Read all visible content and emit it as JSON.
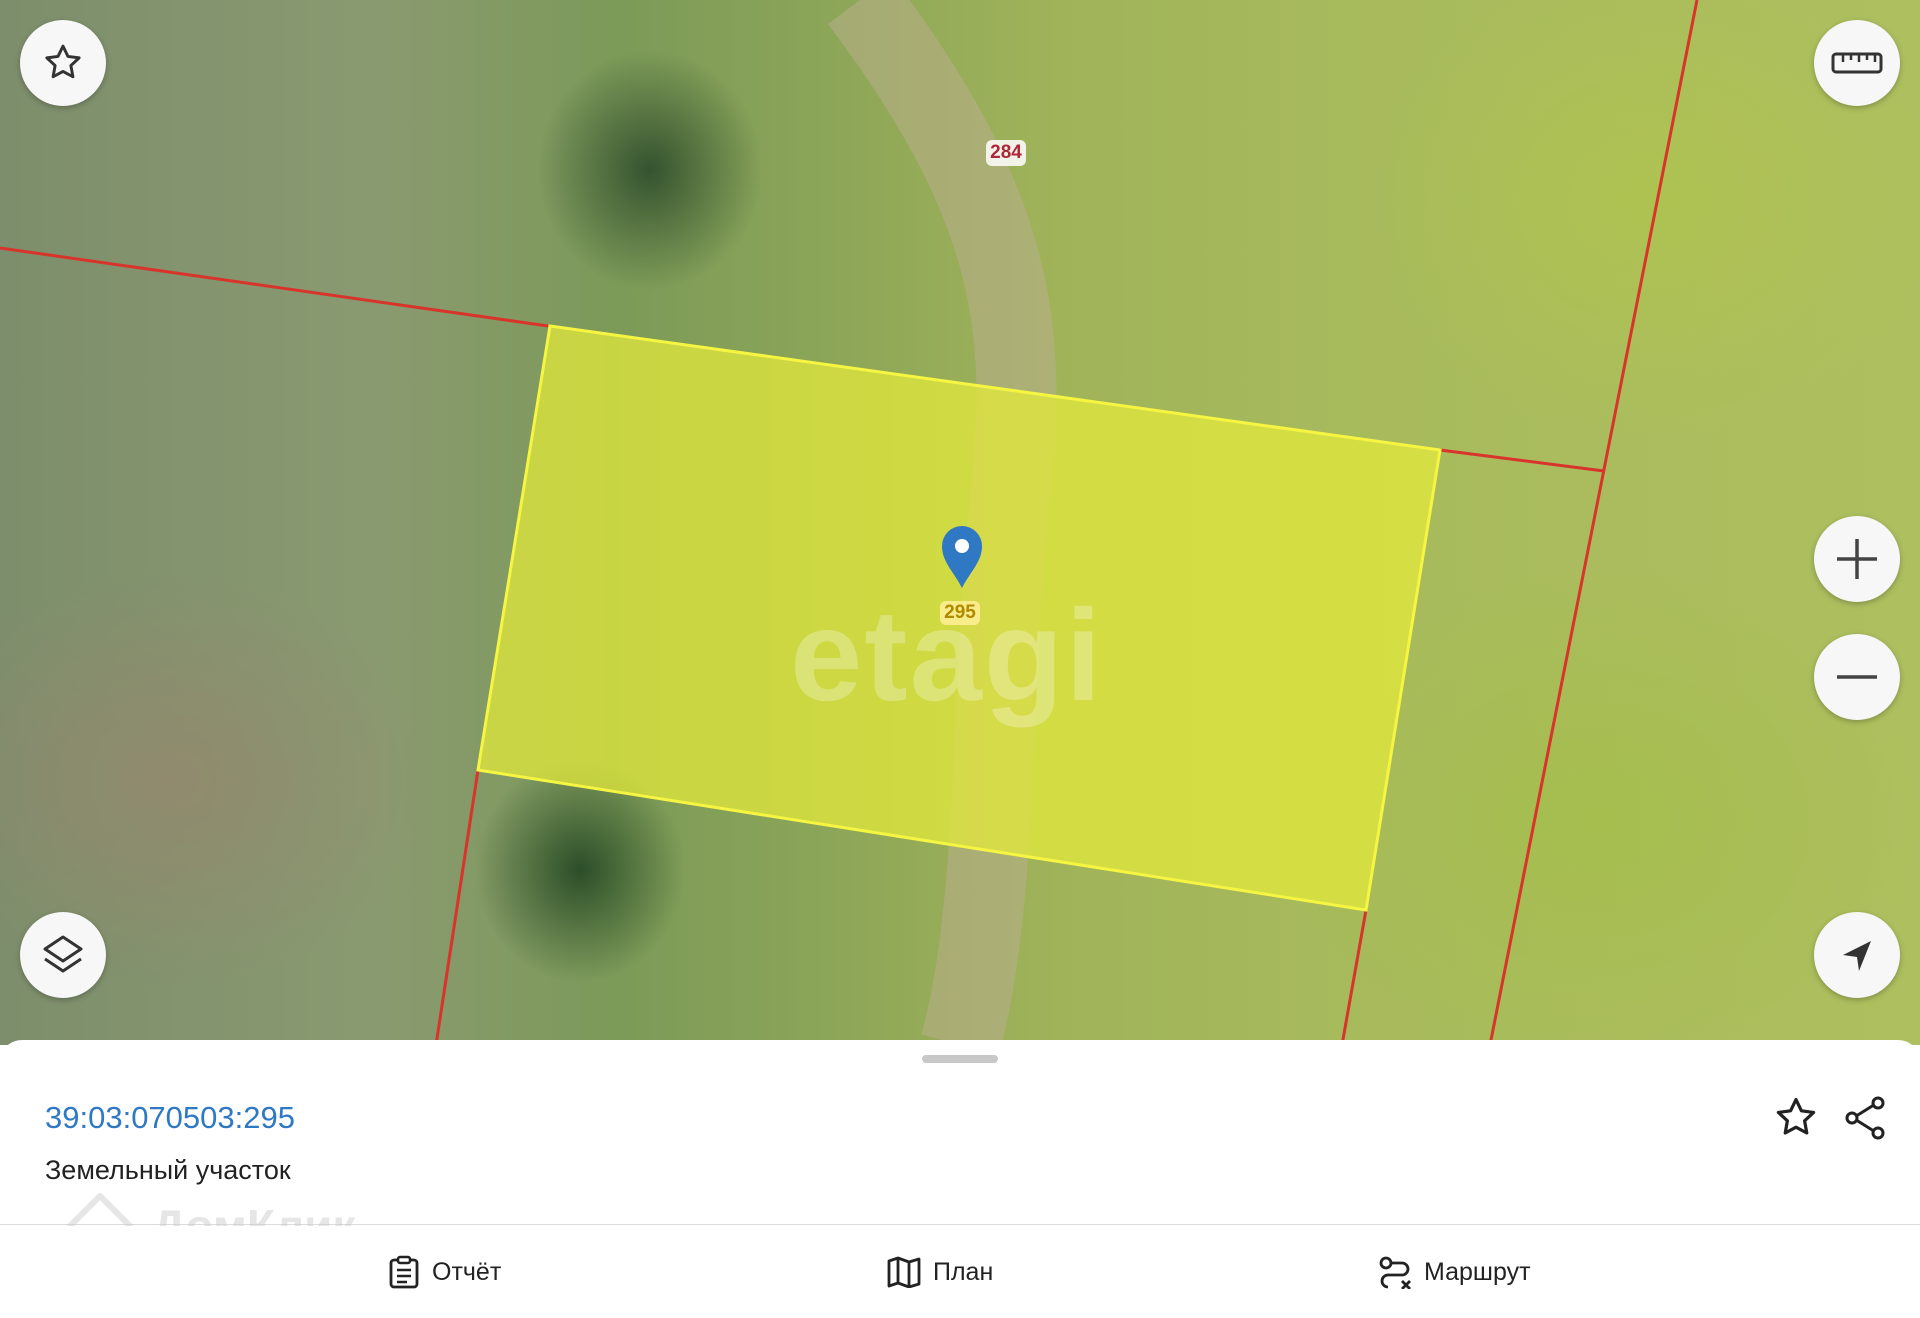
{
  "map": {
    "parcel_labels": {
      "neighbor": "284",
      "selected": "295"
    },
    "watermark": "etagi",
    "colors": {
      "selected_fill": "#e6ec3a",
      "selected_stroke": "#f5f542",
      "boundary": "#d9342b",
      "marker": "#2f78c4"
    },
    "controls": {
      "favorite_icon": "star-outline-icon",
      "ruler_icon": "ruler-icon",
      "zoom_in_icon": "plus-icon",
      "zoom_out_icon": "minus-icon",
      "layers_icon": "layers-icon",
      "locate_icon": "navigation-arrow-icon"
    }
  },
  "sheet": {
    "cadastral_number": "39:03:070503:295",
    "type": "Земельный участок",
    "favorite_icon": "star-outline-icon",
    "share_icon": "share-icon"
  },
  "brand_watermark": "ДомКлик",
  "actions": [
    {
      "label": "Отчёт",
      "icon": "clipboard-icon"
    },
    {
      "label": "План",
      "icon": "map-book-icon"
    },
    {
      "label": "Маршрут",
      "icon": "route-icon"
    }
  ]
}
